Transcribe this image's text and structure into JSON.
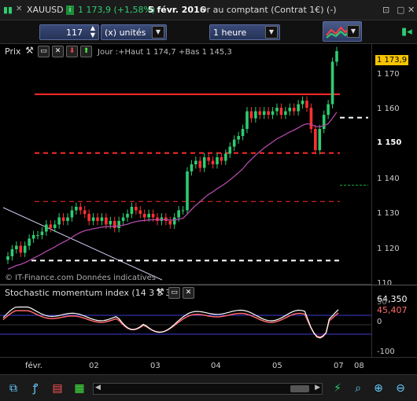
{
  "titlebar": {
    "symbol": "XAUUSD",
    "price_change": "1 173,9 (+1,58%)",
    "date": "5 févr. 2016",
    "market": "Or au comptant (Contrat 1€) (-)"
  },
  "toolbar": {
    "units_value": "117",
    "units_label": "(x) unités",
    "timeframe": "1 heure"
  },
  "price_pane": {
    "label": "Prix",
    "info": "Jour :+Haut 1 174,7 +Bas 1 145,3",
    "watermark": "© IT-Finance.com  Données indicatives",
    "last_price_tag": "1 173,9",
    "ticks": [
      "1 170",
      "1 160",
      "1 150",
      "1 140",
      "1 130",
      "1 120",
      "110"
    ]
  },
  "stoch_pane": {
    "label": "Stochastic momentum index (14 3 5 3)",
    "value1": "64,350",
    "value2": "45,407",
    "ticks": [
      "50",
      "0",
      "-100"
    ]
  },
  "date_axis": [
    "févr.",
    "02",
    "03",
    "04",
    "05",
    "07",
    "08"
  ],
  "colors": {
    "bull": "#2ecc71",
    "bear": "#ff3030",
    "ma": "#b04aa6",
    "tag": "#f6c400",
    "stoch_main": "#ffffff",
    "stoch_signal": "#ff6a6a",
    "band": "#3b3bd6"
  },
  "chart_data": {
    "type": "candlestick",
    "x_labels": [
      "févr.",
      "02",
      "03",
      "04",
      "05",
      "07",
      "08"
    ],
    "closes": [
      1116,
      1118,
      1119,
      1117,
      1119,
      1121,
      1122,
      1122,
      1123,
      1125,
      1124,
      1125,
      1127,
      1126,
      1127,
      1129,
      1130,
      1129,
      1128,
      1126,
      1127,
      1126,
      1127,
      1125,
      1126,
      1124,
      1126,
      1127,
      1128,
      1130,
      1129,
      1128,
      1127,
      1128,
      1127,
      1126,
      1127,
      1126,
      1125,
      1127,
      1129,
      1129,
      1140,
      1142,
      1143,
      1141,
      1144,
      1143,
      1142,
      1144,
      1143,
      1145,
      1147,
      1149,
      1150,
      1152,
      1157,
      1155,
      1157,
      1156,
      1157,
      1156,
      1157,
      1158,
      1156,
      1157,
      1158,
      1157,
      1159,
      1160,
      1158,
      1152,
      1146,
      1152,
      1156,
      1159,
      1171,
      1174
    ],
    "moving_average_end": 1157,
    "levels": [
      {
        "price": 1161.8,
        "style": "solid",
        "color": "red"
      },
      {
        "price": 1155.2,
        "style": "dashed",
        "color": "white"
      },
      {
        "price": 1145.2,
        "style": "dashed",
        "color": "red"
      },
      {
        "price": 1136.1,
        "style": "dashed",
        "color": "green"
      },
      {
        "price": 1131.5,
        "style": "dashed",
        "color": "red"
      },
      {
        "price": 1114.8,
        "style": "dashed",
        "color": "white"
      }
    ],
    "ylim": [
      1108,
      1176
    ],
    "stochastic": {
      "main_last": 64.35,
      "signal_last": 45.407,
      "bands": [
        40,
        -40
      ],
      "ylim": [
        -100,
        100
      ]
    }
  }
}
